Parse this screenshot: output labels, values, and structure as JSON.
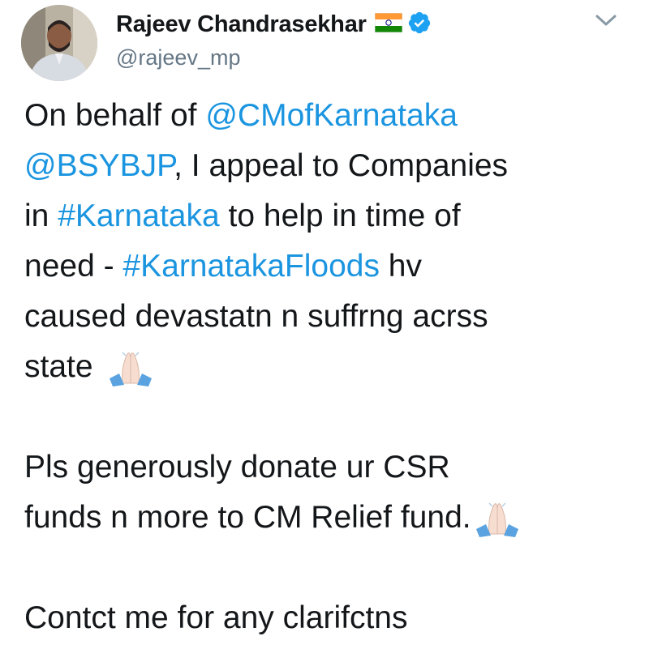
{
  "author": {
    "display_name": "Rajeev Chandrasekhar",
    "handle": "@rajeev_mp",
    "flag_icon": "india-flag-icon",
    "verified_icon": "verified-badge-icon",
    "verified_color": "#1da1f2"
  },
  "menu": {
    "caret_icon": "chevron-down-icon"
  },
  "tweet": {
    "link_color": "#1b95e0",
    "p1": {
      "l1_a": "On behalf of ",
      "l1_link": "@CMofKarnataka",
      "l2_link": "@BSYBJP",
      "l2_b": ", I appeal to Companies",
      "l3_a": "in ",
      "l3_link": "#Karnataka",
      "l3_b": " to help in time of",
      "l4_a": "need - ",
      "l4_link": "#KarnatakaFloods",
      "l4_b": " hv",
      "l5": "caused devastatn n suffrng acrss",
      "l6": "state "
    },
    "p2": {
      "l1": "Pls generously donate ur CSR",
      "l2": "funds n more to CM Relief fund."
    },
    "p3": {
      "l1": "Contct me for any clarifctns"
    },
    "emoji_icon": "folded-hands-emoji-icon"
  }
}
